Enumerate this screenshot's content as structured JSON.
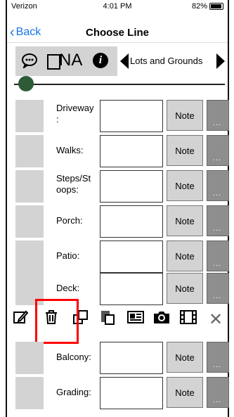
{
  "status": {
    "carrier": "Verizon",
    "time": "4:01 PM",
    "battery": "82%"
  },
  "nav": {
    "back": "Back",
    "title": "Choose Line"
  },
  "toolbar": {
    "na_label": "NA",
    "section": "Lots and Grounds"
  },
  "rows": [
    {
      "label": "Driveway\n:",
      "note": "Note",
      "more": "..."
    },
    {
      "label": "Walks:",
      "note": "Note",
      "more": "..."
    },
    {
      "label": "Steps/St\noops:",
      "note": "Note",
      "more": "..."
    },
    {
      "label": "Porch:",
      "note": "Note",
      "more": "..."
    },
    {
      "label": "Patio:",
      "note": "Note",
      "more": "..."
    },
    {
      "label": "Deck:",
      "note": "Note",
      "more": "..."
    },
    {
      "label": "Balcony:",
      "note": "Note",
      "more": "..."
    },
    {
      "label": "Grading:",
      "note": "Note",
      "more": "..."
    }
  ],
  "icons": {
    "comment": "speech-bubble-icon",
    "info": "info-icon",
    "edit": "pencil-icon",
    "delete": "trash-icon",
    "copy": "copy-icon",
    "paste": "paste-icon",
    "details": "card-icon",
    "camera": "camera-icon",
    "video": "film-icon",
    "close": "close-icon"
  },
  "highlight_color": "#ff0000"
}
